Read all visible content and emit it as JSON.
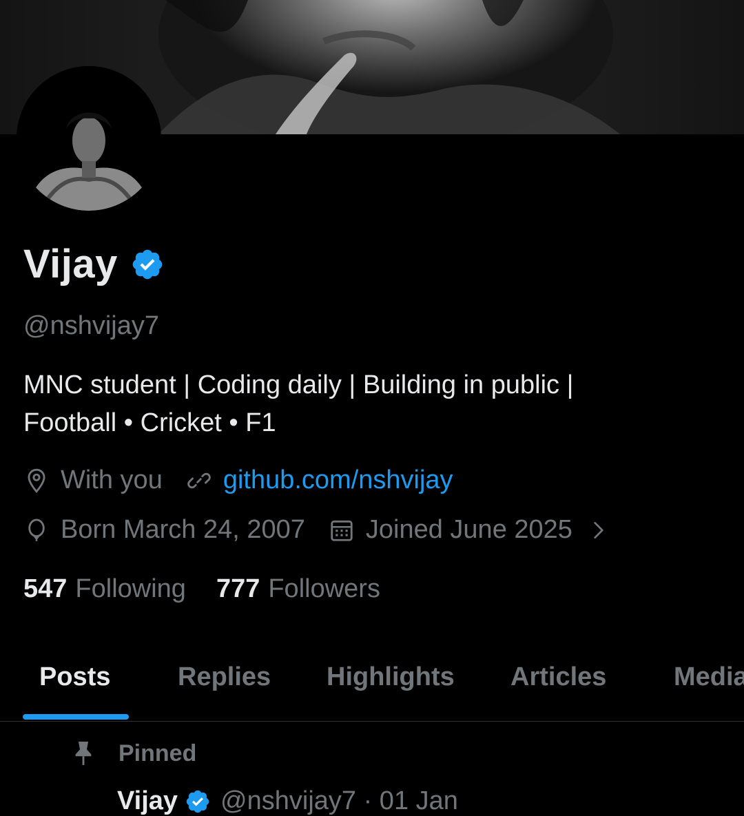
{
  "profile": {
    "display_name": "Vijay",
    "handle": "@nshvijay7",
    "bio_line1": "MNC student | Coding daily | Building in public |",
    "bio_line2": "Football • Cricket • F1",
    "location": "With you",
    "website": "github.com/nshvijay",
    "birthday": "Born March 24, 2007",
    "joined": "Joined June 2025",
    "following_count": "547",
    "following_label": "Following",
    "followers_count": "777",
    "followers_label": "Followers"
  },
  "tabs": [
    {
      "label": "Posts",
      "active": true
    },
    {
      "label": "Replies",
      "active": false
    },
    {
      "label": "Highlights",
      "active": false
    },
    {
      "label": "Articles",
      "active": false
    },
    {
      "label": "Media",
      "active": false
    }
  ],
  "pinned": {
    "label": "Pinned",
    "author": "Vijay",
    "handle_date": "@nshvijay7 · 01 Jan"
  },
  "icons": {
    "verified": "verified-badge-icon",
    "location": "location-pin-icon",
    "link": "link-icon",
    "birthday": "balloon-icon",
    "joined": "calendar-icon",
    "chevron": "chevron-right-icon",
    "pin": "pin-icon"
  },
  "colors": {
    "background": "#000000",
    "accent": "#1d9bf0",
    "primary_text": "#e7e9ea",
    "secondary_text": "#71767b"
  }
}
